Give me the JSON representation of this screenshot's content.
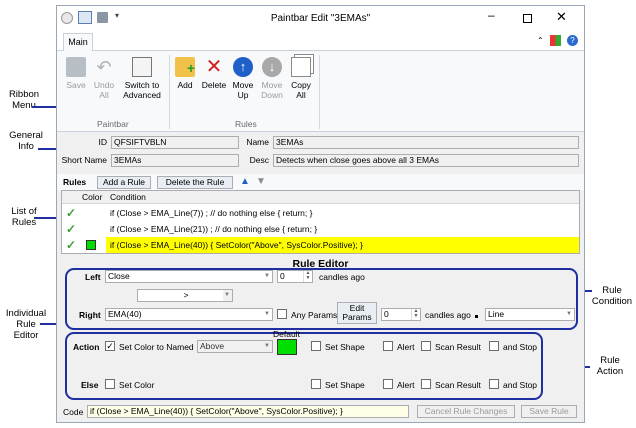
{
  "window": {
    "title": "Paintbar Edit \"3EMAs\""
  },
  "ribbon": {
    "tab": "Main",
    "buttons": {
      "save": "Save",
      "undo_all": [
        "Undo",
        "All"
      ],
      "switch": [
        "Switch to",
        "Advanced"
      ],
      "add": "Add",
      "delete": "Delete",
      "move_up": [
        "Move",
        "Up"
      ],
      "move_down": [
        "Move",
        "Down"
      ],
      "copy_all": [
        "Copy",
        "All"
      ]
    },
    "groups": {
      "paintbar": "Paintbar",
      "rules": "Rules"
    }
  },
  "general": {
    "id_label": "ID",
    "id_value": "QFSIFTVBLN",
    "name_label": "Name",
    "name_value": "3EMAs",
    "short_label": "Short Name",
    "short_value": "3EMAs",
    "desc_label": "Desc",
    "desc_value": "Detects when close goes above all 3 EMAs"
  },
  "rules_bar": {
    "label": "Rules",
    "add": "Add a Rule",
    "delete": "Delete the Rule"
  },
  "grid": {
    "headers": {
      "color": "Color",
      "condition": "Condition"
    },
    "rows": [
      {
        "condition": "if (Close > EMA_Line(7)) ; // do nothing else { return; }",
        "swatch": ""
      },
      {
        "condition": "if (Close > EMA_Line(21)) ; // do nothing else { return; }",
        "swatch": ""
      },
      {
        "condition": "if (Close > EMA_Line(40)) { SetColor(\"Above\", SysColor.Positive); }",
        "swatch": "#00dd00"
      }
    ],
    "highlight_color": "#ffff00"
  },
  "editor": {
    "title": "Rule Editor",
    "left_label": "Left",
    "left_value": "Close",
    "left_ago": "0",
    "candles_ago": "candles ago",
    "operator": ">",
    "right_label": "Right",
    "right_value": "EMA(40)",
    "any_params": "Any Params",
    "edit_params": [
      "Edit",
      "Params"
    ],
    "right_ago": "0",
    "right_style": "Line",
    "action_label": "Action",
    "set_color_named": "Set Color to Named",
    "color_name": "Above",
    "default_label": "Default",
    "swatch_color": "#00dd00",
    "set_shape": "Set Shape",
    "alert": "Alert",
    "scan_result": "Scan Result",
    "and_stop": "and Stop",
    "else_label": "Else",
    "set_color": "Set Color"
  },
  "footer": {
    "code_label": "Code",
    "code_value": "if (Close > EMA_Line(40)) {  SetColor(\"Above\", SysColor.Positive); }",
    "cancel": "Cancel Rule Changes",
    "save": "Save Rule"
  },
  "annotations": {
    "ribbon_menu": [
      "Ribbon",
      "Menu"
    ],
    "general_info": [
      "General",
      "Info"
    ],
    "list_of_rules": [
      "List of",
      "Rules"
    ],
    "individual": [
      "Individual",
      "Rule",
      "Editor"
    ],
    "rule_condition": [
      "Rule",
      "Condition"
    ],
    "rule_action": [
      "Rule",
      "Action"
    ]
  },
  "colors": {
    "accent": "#1f2fa0",
    "check": "#3aa03a"
  }
}
